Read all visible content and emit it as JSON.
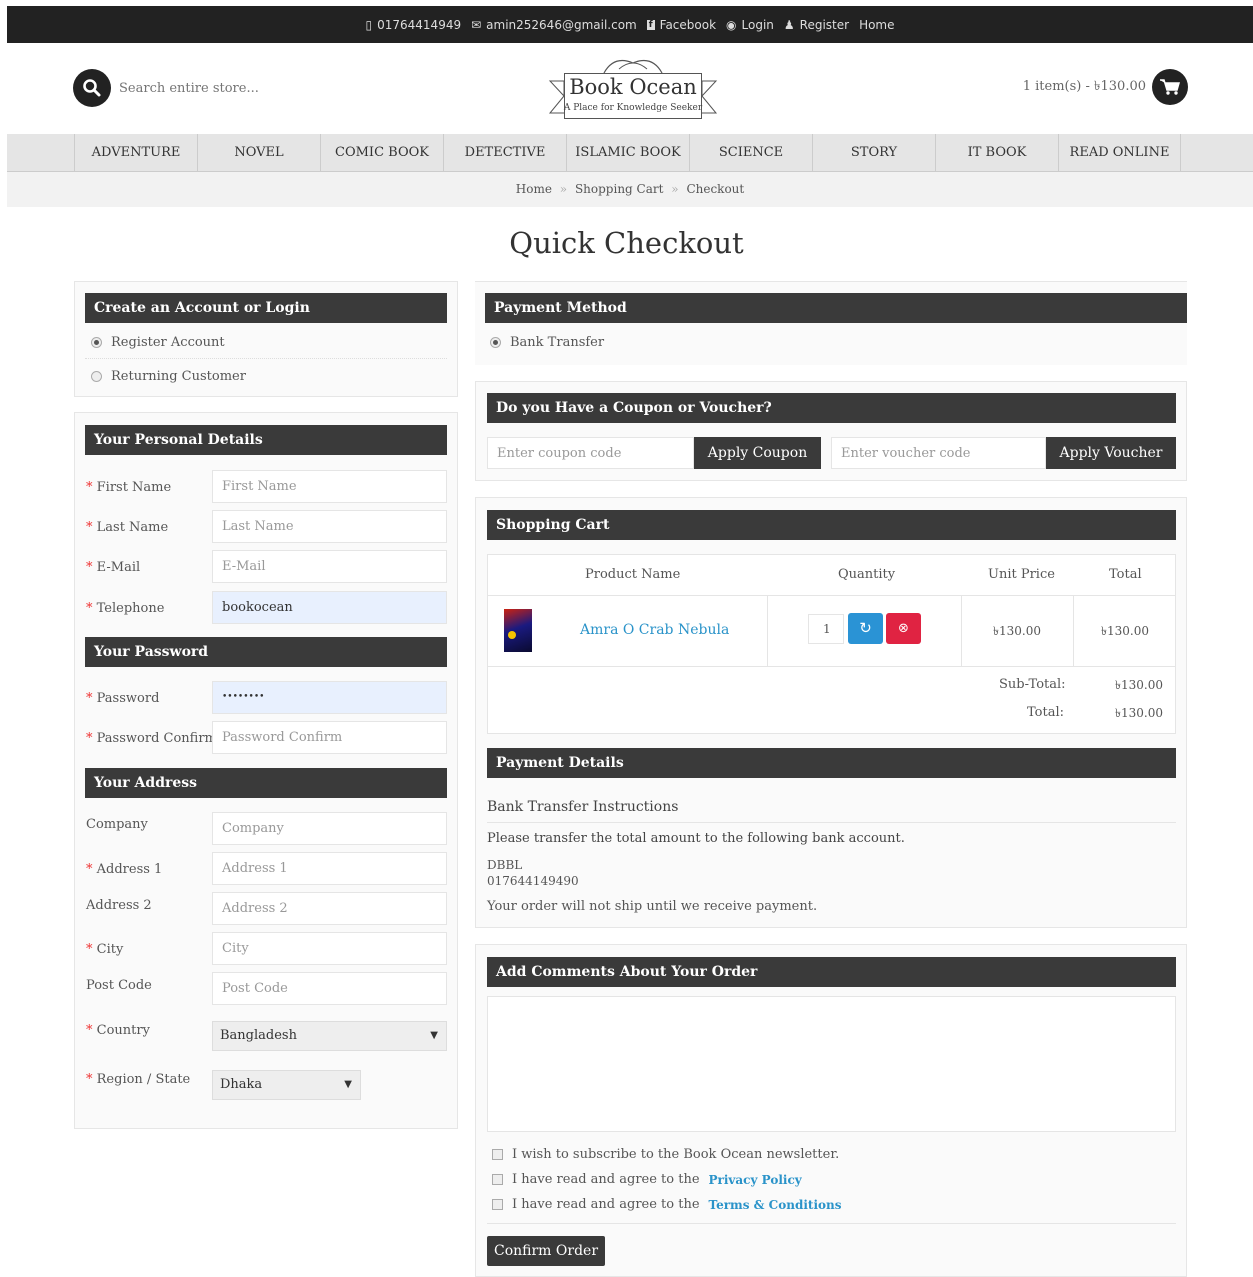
{
  "topbar": {
    "phone": "01764414949",
    "email": "amin252646@gmail.com",
    "facebook": "Facebook",
    "login": "Login",
    "register": "Register",
    "home": "Home"
  },
  "header": {
    "search_placeholder": "Search entire store...",
    "logo_title": "Book Ocean",
    "logo_tagline": "A Place for Knowledge Seeker",
    "cart_summary": "1 item(s) - ৳130.00"
  },
  "nav": [
    "ADVENTURE",
    "NOVEL",
    "COMIC BOOK",
    "DETECTIVE STORY",
    "ISLAMIC BOOK",
    "SCIENCE FICTION",
    "STORY",
    "IT BOOK",
    "READ ONLINE"
  ],
  "breadcrumb": {
    "home": "Home",
    "sep": "»",
    "cart": "Shopping Cart",
    "checkout": "Checkout"
  },
  "page_title": "Quick Checkout",
  "account": {
    "title": "Create an Account or Login",
    "register": "Register Account",
    "returning": "Returning Customer"
  },
  "personal": {
    "title": "Your Personal Details",
    "first_name": {
      "label": "First Name",
      "placeholder": "First Name"
    },
    "last_name": {
      "label": "Last Name",
      "placeholder": "Last Name"
    },
    "email": {
      "label": "E-Mail",
      "placeholder": "E-Mail"
    },
    "telephone": {
      "label": "Telephone",
      "value": "bookocean"
    }
  },
  "password": {
    "title": "Your Password",
    "password": {
      "label": "Password",
      "value": "••••••••"
    },
    "confirm": {
      "label": "Password Confirm",
      "placeholder": "Password Confirm"
    }
  },
  "address": {
    "title": "Your Address",
    "company": {
      "label": "Company",
      "placeholder": "Company"
    },
    "address1": {
      "label": "Address 1",
      "placeholder": "Address 1"
    },
    "address2": {
      "label": "Address 2",
      "placeholder": "Address 2"
    },
    "city": {
      "label": "City",
      "placeholder": "City"
    },
    "postcode": {
      "label": "Post Code",
      "placeholder": "Post Code"
    },
    "country": {
      "label": "Country",
      "value": "Bangladesh"
    },
    "region": {
      "label": "Region / State",
      "value": "Dhaka"
    }
  },
  "payment": {
    "title": "Payment Method",
    "option": "Bank Transfer"
  },
  "coupon": {
    "title": "Do you Have a Coupon or Voucher?",
    "coupon_placeholder": "Enter coupon code",
    "coupon_button": "Apply Coupon",
    "voucher_placeholder": "Enter voucher code",
    "voucher_button": "Apply Voucher"
  },
  "cart": {
    "title": "Shopping Cart",
    "headers": [
      "Product Name",
      "Quantity",
      "Unit Price",
      "Total"
    ],
    "item": {
      "name": "Amra O Crab Nebula",
      "qty": "1",
      "unit_price": "৳130.00",
      "total": "৳130.00"
    },
    "subtotal_label": "Sub-Total:",
    "subtotal": "৳130.00",
    "total_label": "Total:",
    "total": "৳130.00"
  },
  "payment_details": {
    "title": "Payment Details",
    "heading": "Bank Transfer Instructions",
    "instruction": "Please transfer the total amount to the following bank account.",
    "bank": "DBBL",
    "account": "017644149490",
    "note": "Your order will not ship until we receive payment."
  },
  "comments": {
    "title": "Add Comments About Your Order",
    "newsletter": "I wish to subscribe to the Book Ocean newsletter.",
    "privacy_prefix": "I have read and agree to the",
    "privacy_link": "Privacy Policy",
    "terms_prefix": "I have read and agree to the",
    "terms_link": "Terms & Conditions",
    "confirm_button": "Confirm Order"
  }
}
